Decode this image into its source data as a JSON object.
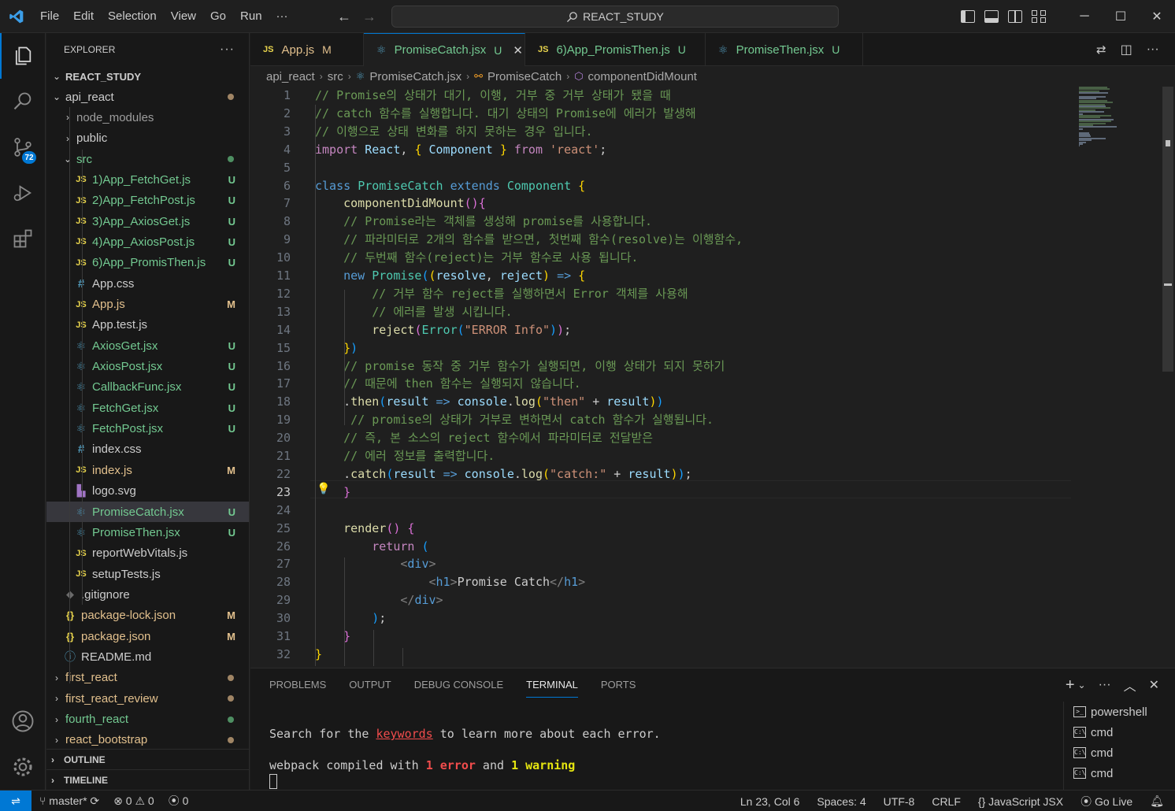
{
  "menu": [
    "File",
    "Edit",
    "Selection",
    "View",
    "Go",
    "Run",
    "···"
  ],
  "search": {
    "label": "REACT_STUDY"
  },
  "activity": {
    "scm_badge": "72"
  },
  "explorer": {
    "title": "EXPLORER",
    "root": "REACT_STUDY",
    "rows": [
      {
        "name": "api_react",
        "kind": "folder-open",
        "depth": 1,
        "status": "",
        "dot": "modified",
        "color": "default"
      },
      {
        "name": "node_modules",
        "kind": "folder",
        "depth": 2,
        "status": "",
        "dot": "",
        "color": "dim"
      },
      {
        "name": "public",
        "kind": "folder",
        "depth": 2,
        "status": "",
        "dot": "",
        "color": "default"
      },
      {
        "name": "src",
        "kind": "folder-open",
        "depth": 2,
        "status": "",
        "dot": "untracked",
        "color": "untracked"
      },
      {
        "name": "1)App_FetchGet.js",
        "kind": "js",
        "depth": 3,
        "status": "U",
        "color": "untracked"
      },
      {
        "name": "2)App_FetchPost.js",
        "kind": "js",
        "depth": 3,
        "status": "U",
        "color": "untracked"
      },
      {
        "name": "3)App_AxiosGet.js",
        "kind": "js",
        "depth": 3,
        "status": "U",
        "color": "untracked"
      },
      {
        "name": "4)App_AxiosPost.js",
        "kind": "js",
        "depth": 3,
        "status": "U",
        "color": "untracked"
      },
      {
        "name": "6)App_PromisThen.js",
        "kind": "js",
        "depth": 3,
        "status": "U",
        "color": "untracked"
      },
      {
        "name": "App.css",
        "kind": "css",
        "depth": 3,
        "status": "",
        "color": "default"
      },
      {
        "name": "App.js",
        "kind": "js",
        "depth": 3,
        "status": "M",
        "color": "modified"
      },
      {
        "name": "App.test.js",
        "kind": "js",
        "depth": 3,
        "status": "",
        "color": "default"
      },
      {
        "name": "AxiosGet.jsx",
        "kind": "react",
        "depth": 3,
        "status": "U",
        "color": "untracked"
      },
      {
        "name": "AxiosPost.jsx",
        "kind": "react",
        "depth": 3,
        "status": "U",
        "color": "untracked"
      },
      {
        "name": "CallbackFunc.jsx",
        "kind": "react",
        "depth": 3,
        "status": "U",
        "color": "untracked"
      },
      {
        "name": "FetchGet.jsx",
        "kind": "react",
        "depth": 3,
        "status": "U",
        "color": "untracked"
      },
      {
        "name": "FetchPost.jsx",
        "kind": "react",
        "depth": 3,
        "status": "U",
        "color": "untracked"
      },
      {
        "name": "index.css",
        "kind": "css",
        "depth": 3,
        "status": "",
        "color": "default"
      },
      {
        "name": "index.js",
        "kind": "js",
        "depth": 3,
        "status": "M",
        "color": "modified"
      },
      {
        "name": "logo.svg",
        "kind": "svg",
        "depth": 3,
        "status": "",
        "color": "default"
      },
      {
        "name": "PromiseCatch.jsx",
        "kind": "react",
        "depth": 3,
        "status": "U",
        "color": "untracked",
        "selected": true
      },
      {
        "name": "PromiseThen.jsx",
        "kind": "react",
        "depth": 3,
        "status": "U",
        "color": "untracked"
      },
      {
        "name": "reportWebVitals.js",
        "kind": "js",
        "depth": 3,
        "status": "",
        "color": "default"
      },
      {
        "name": "setupTests.js",
        "kind": "js",
        "depth": 3,
        "status": "",
        "color": "default"
      },
      {
        "name": ".gitignore",
        "kind": "git",
        "depth": 2,
        "status": "",
        "color": "default"
      },
      {
        "name": "package-lock.json",
        "kind": "json",
        "depth": 2,
        "status": "M",
        "color": "modified"
      },
      {
        "name": "package.json",
        "kind": "json",
        "depth": 2,
        "status": "M",
        "color": "modified"
      },
      {
        "name": "README.md",
        "kind": "info",
        "depth": 2,
        "status": "",
        "color": "default"
      },
      {
        "name": "first_react",
        "kind": "folder",
        "depth": 1,
        "status": "",
        "dot": "modified",
        "color": "modified"
      },
      {
        "name": "first_react_review",
        "kind": "folder",
        "depth": 1,
        "status": "",
        "dot": "modified",
        "color": "modified"
      },
      {
        "name": "fourth_react",
        "kind": "folder",
        "depth": 1,
        "status": "",
        "dot": "untracked",
        "color": "untracked"
      },
      {
        "name": "react_bootstrap",
        "kind": "folder",
        "depth": 1,
        "status": "",
        "dot": "modified",
        "color": "modified"
      }
    ],
    "outline": "OUTLINE",
    "timeline": "TIMELINE"
  },
  "tabs": [
    {
      "icon": "JS",
      "label": "App.js",
      "status": "M",
      "active": false,
      "color": "modified"
    },
    {
      "icon": "react",
      "label": "PromiseCatch.jsx",
      "status": "U",
      "active": true,
      "color": "untracked"
    },
    {
      "icon": "JS",
      "label": "6)App_PromisThen.js",
      "status": "U",
      "active": false,
      "color": "untracked"
    },
    {
      "icon": "react",
      "label": "PromiseThen.jsx",
      "status": "U",
      "active": false,
      "color": "untracked"
    }
  ],
  "breadcrumb": [
    "api_react",
    "src",
    "PromiseCatch.jsx",
    "PromiseCatch",
    "componentDidMount"
  ],
  "editor": {
    "current_line": 23,
    "lines": [
      [
        [
          "c",
          "// Promise의 상태가 대기, 이행, 거부 중 거부 상태가 됐을 때"
        ]
      ],
      [
        [
          "c",
          "// catch 함수를 실행합니다. 대기 상태의 Promise에 에러가 발생해"
        ]
      ],
      [
        [
          "c",
          "// 이행으로 상태 변화를 하지 못하는 경우 입니다."
        ]
      ],
      [
        [
          "f",
          "import"
        ],
        [
          "t",
          " "
        ],
        [
          "v",
          "React"
        ],
        [
          "t",
          ", "
        ],
        [
          "p1",
          "{"
        ],
        [
          "t",
          " "
        ],
        [
          "v",
          "Component"
        ],
        [
          "t",
          " "
        ],
        [
          "p1",
          "}"
        ],
        [
          "t",
          " "
        ],
        [
          "f",
          "from"
        ],
        [
          "t",
          " "
        ],
        [
          "s",
          "'react'"
        ],
        [
          "t",
          ";"
        ]
      ],
      [],
      [
        [
          "k",
          "class"
        ],
        [
          "t",
          " "
        ],
        [
          "cls",
          "PromiseCatch"
        ],
        [
          "t",
          " "
        ],
        [
          "k",
          "extends"
        ],
        [
          "t",
          " "
        ],
        [
          "cls",
          "Component"
        ],
        [
          "t",
          " "
        ],
        [
          "p1",
          "{"
        ]
      ],
      [
        [
          "t",
          "    "
        ],
        [
          "fn",
          "componentDidMount"
        ],
        [
          "p2",
          "()"
        ],
        [
          "p2",
          "{"
        ]
      ],
      [
        [
          "t",
          "    "
        ],
        [
          "c",
          "// Promise라는 객체를 생성해 promise를 사용합니다."
        ]
      ],
      [
        [
          "t",
          "    "
        ],
        [
          "c",
          "// 파라미터로 2개의 함수를 받으면, 첫번째 함수(resolve)는 이행함수,"
        ]
      ],
      [
        [
          "t",
          "    "
        ],
        [
          "c",
          "// 두번째 함수(reject)는 거부 함수로 사용 됩니다."
        ]
      ],
      [
        [
          "t",
          "    "
        ],
        [
          "k",
          "new"
        ],
        [
          "t",
          " "
        ],
        [
          "cls",
          "Promise"
        ],
        [
          "p3",
          "("
        ],
        [
          "p1",
          "("
        ],
        [
          "v",
          "resolve"
        ],
        [
          "t",
          ", "
        ],
        [
          "v",
          "reject"
        ],
        [
          "p1",
          ")"
        ],
        [
          "t",
          " "
        ],
        [
          "k",
          "=>"
        ],
        [
          "t",
          " "
        ],
        [
          "p1",
          "{"
        ]
      ],
      [
        [
          "t",
          "        "
        ],
        [
          "c",
          "// 거부 함수 reject를 실행하면서 Error 객체를 사용해"
        ]
      ],
      [
        [
          "t",
          "        "
        ],
        [
          "c",
          "// 에러를 발생 시킵니다."
        ]
      ],
      [
        [
          "t",
          "        "
        ],
        [
          "fn",
          "reject"
        ],
        [
          "p2",
          "("
        ],
        [
          "cls",
          "Error"
        ],
        [
          "p3",
          "("
        ],
        [
          "s",
          "\"ERROR Info\""
        ],
        [
          "p3",
          ")"
        ],
        [
          "p2",
          ")"
        ],
        [
          "t",
          ";"
        ]
      ],
      [
        [
          "t",
          "    "
        ],
        [
          "p1",
          "}"
        ],
        [
          "p3",
          ")"
        ]
      ],
      [
        [
          "t",
          "    "
        ],
        [
          "c",
          "// promise 동작 중 거부 함수가 실행되면, 이행 상태가 되지 못하기"
        ]
      ],
      [
        [
          "t",
          "    "
        ],
        [
          "c",
          "// 때문에 then 함수는 실행되지 않습니다."
        ]
      ],
      [
        [
          "t",
          "    ."
        ],
        [
          "fn",
          "then"
        ],
        [
          "p3",
          "("
        ],
        [
          "v",
          "result"
        ],
        [
          "t",
          " "
        ],
        [
          "k",
          "=>"
        ],
        [
          "t",
          " "
        ],
        [
          "v",
          "console"
        ],
        [
          "t",
          "."
        ],
        [
          "fn",
          "log"
        ],
        [
          "p1",
          "("
        ],
        [
          "s",
          "\"then\""
        ],
        [
          "t",
          " + "
        ],
        [
          "v",
          "result"
        ],
        [
          "p1",
          ")"
        ],
        [
          "p3",
          ")"
        ]
      ],
      [
        [
          "t",
          "     "
        ],
        [
          "c",
          "// promise의 상태가 거부로 변하면서 catch 함수가 실행됩니다."
        ]
      ],
      [
        [
          "t",
          "    "
        ],
        [
          "c",
          "// 즉, 본 소스의 reject 함수에서 파라미터로 전달받은"
        ]
      ],
      [
        [
          "t",
          "    "
        ],
        [
          "c",
          "// 에러 정보를 출력합니다."
        ]
      ],
      [
        [
          "t",
          "    ."
        ],
        [
          "fn",
          "catch"
        ],
        [
          "p3",
          "("
        ],
        [
          "v",
          "result"
        ],
        [
          "t",
          " "
        ],
        [
          "k",
          "=>"
        ],
        [
          "t",
          " "
        ],
        [
          "v",
          "console"
        ],
        [
          "t",
          "."
        ],
        [
          "fn",
          "log"
        ],
        [
          "p1",
          "("
        ],
        [
          "s",
          "\"catch:\""
        ],
        [
          "t",
          " + "
        ],
        [
          "v",
          "result"
        ],
        [
          "p1",
          ")"
        ],
        [
          "p3",
          ")"
        ],
        [
          "t",
          ";"
        ]
      ],
      [
        [
          "t",
          "    "
        ],
        [
          "p2",
          "}"
        ]
      ],
      [],
      [
        [
          "t",
          "    "
        ],
        [
          "fn",
          "render"
        ],
        [
          "p2",
          "()"
        ],
        [
          "t",
          " "
        ],
        [
          "p2",
          "{"
        ]
      ],
      [
        [
          "t",
          "        "
        ],
        [
          "f",
          "return"
        ],
        [
          "t",
          " "
        ],
        [
          "p3",
          "("
        ]
      ],
      [
        [
          "t",
          "            "
        ],
        [
          "tag",
          "<"
        ],
        [
          "tn",
          "div"
        ],
        [
          "tag",
          ">"
        ]
      ],
      [
        [
          "t",
          "                "
        ],
        [
          "tag",
          "<"
        ],
        [
          "tn",
          "h1"
        ],
        [
          "tag",
          ">"
        ],
        [
          "t",
          "Promise Catch"
        ],
        [
          "tag",
          "</"
        ],
        [
          "tn",
          "h1"
        ],
        [
          "tag",
          ">"
        ]
      ],
      [
        [
          "t",
          "            "
        ],
        [
          "tag",
          "</"
        ],
        [
          "tn",
          "div"
        ],
        [
          "tag",
          ">"
        ]
      ],
      [
        [
          "t",
          "        "
        ],
        [
          "p3",
          ")"
        ],
        [
          "t",
          ";"
        ]
      ],
      [
        [
          "t",
          "    "
        ],
        [
          "p2",
          "}"
        ]
      ],
      [
        [
          "p1",
          "}"
        ]
      ]
    ]
  },
  "panel": {
    "tabs": [
      "PROBLEMS",
      "OUTPUT",
      "DEBUG CONSOLE",
      "TERMINAL",
      "PORTS"
    ],
    "active_tab": "TERMINAL",
    "line1_pre": "Search for the ",
    "line1_link": "keywords",
    "line1_post": " to learn more about each error.",
    "line2_pre": "webpack compiled with ",
    "line2_err": "1 error",
    "line2_mid": " and ",
    "line2_warn": "1 warning",
    "terminals": [
      {
        "icon": ">_",
        "label": "powershell"
      },
      {
        "icon": "C:\\",
        "label": "cmd"
      },
      {
        "icon": "C:\\",
        "label": "cmd"
      },
      {
        "icon": "C:\\",
        "label": "cmd"
      }
    ]
  },
  "status": {
    "branch": "master*",
    "errors": "0",
    "warnings": "0",
    "ports": "0",
    "position": "Ln 23, Col 6",
    "spaces": "Spaces: 4",
    "encoding": "UTF-8",
    "eol": "CRLF",
    "language": "JavaScript JSX",
    "golive": "Go Live"
  },
  "colors": {
    "accent": "#0078d4",
    "untracked": "#73c991",
    "modified": "#e2c08d"
  }
}
